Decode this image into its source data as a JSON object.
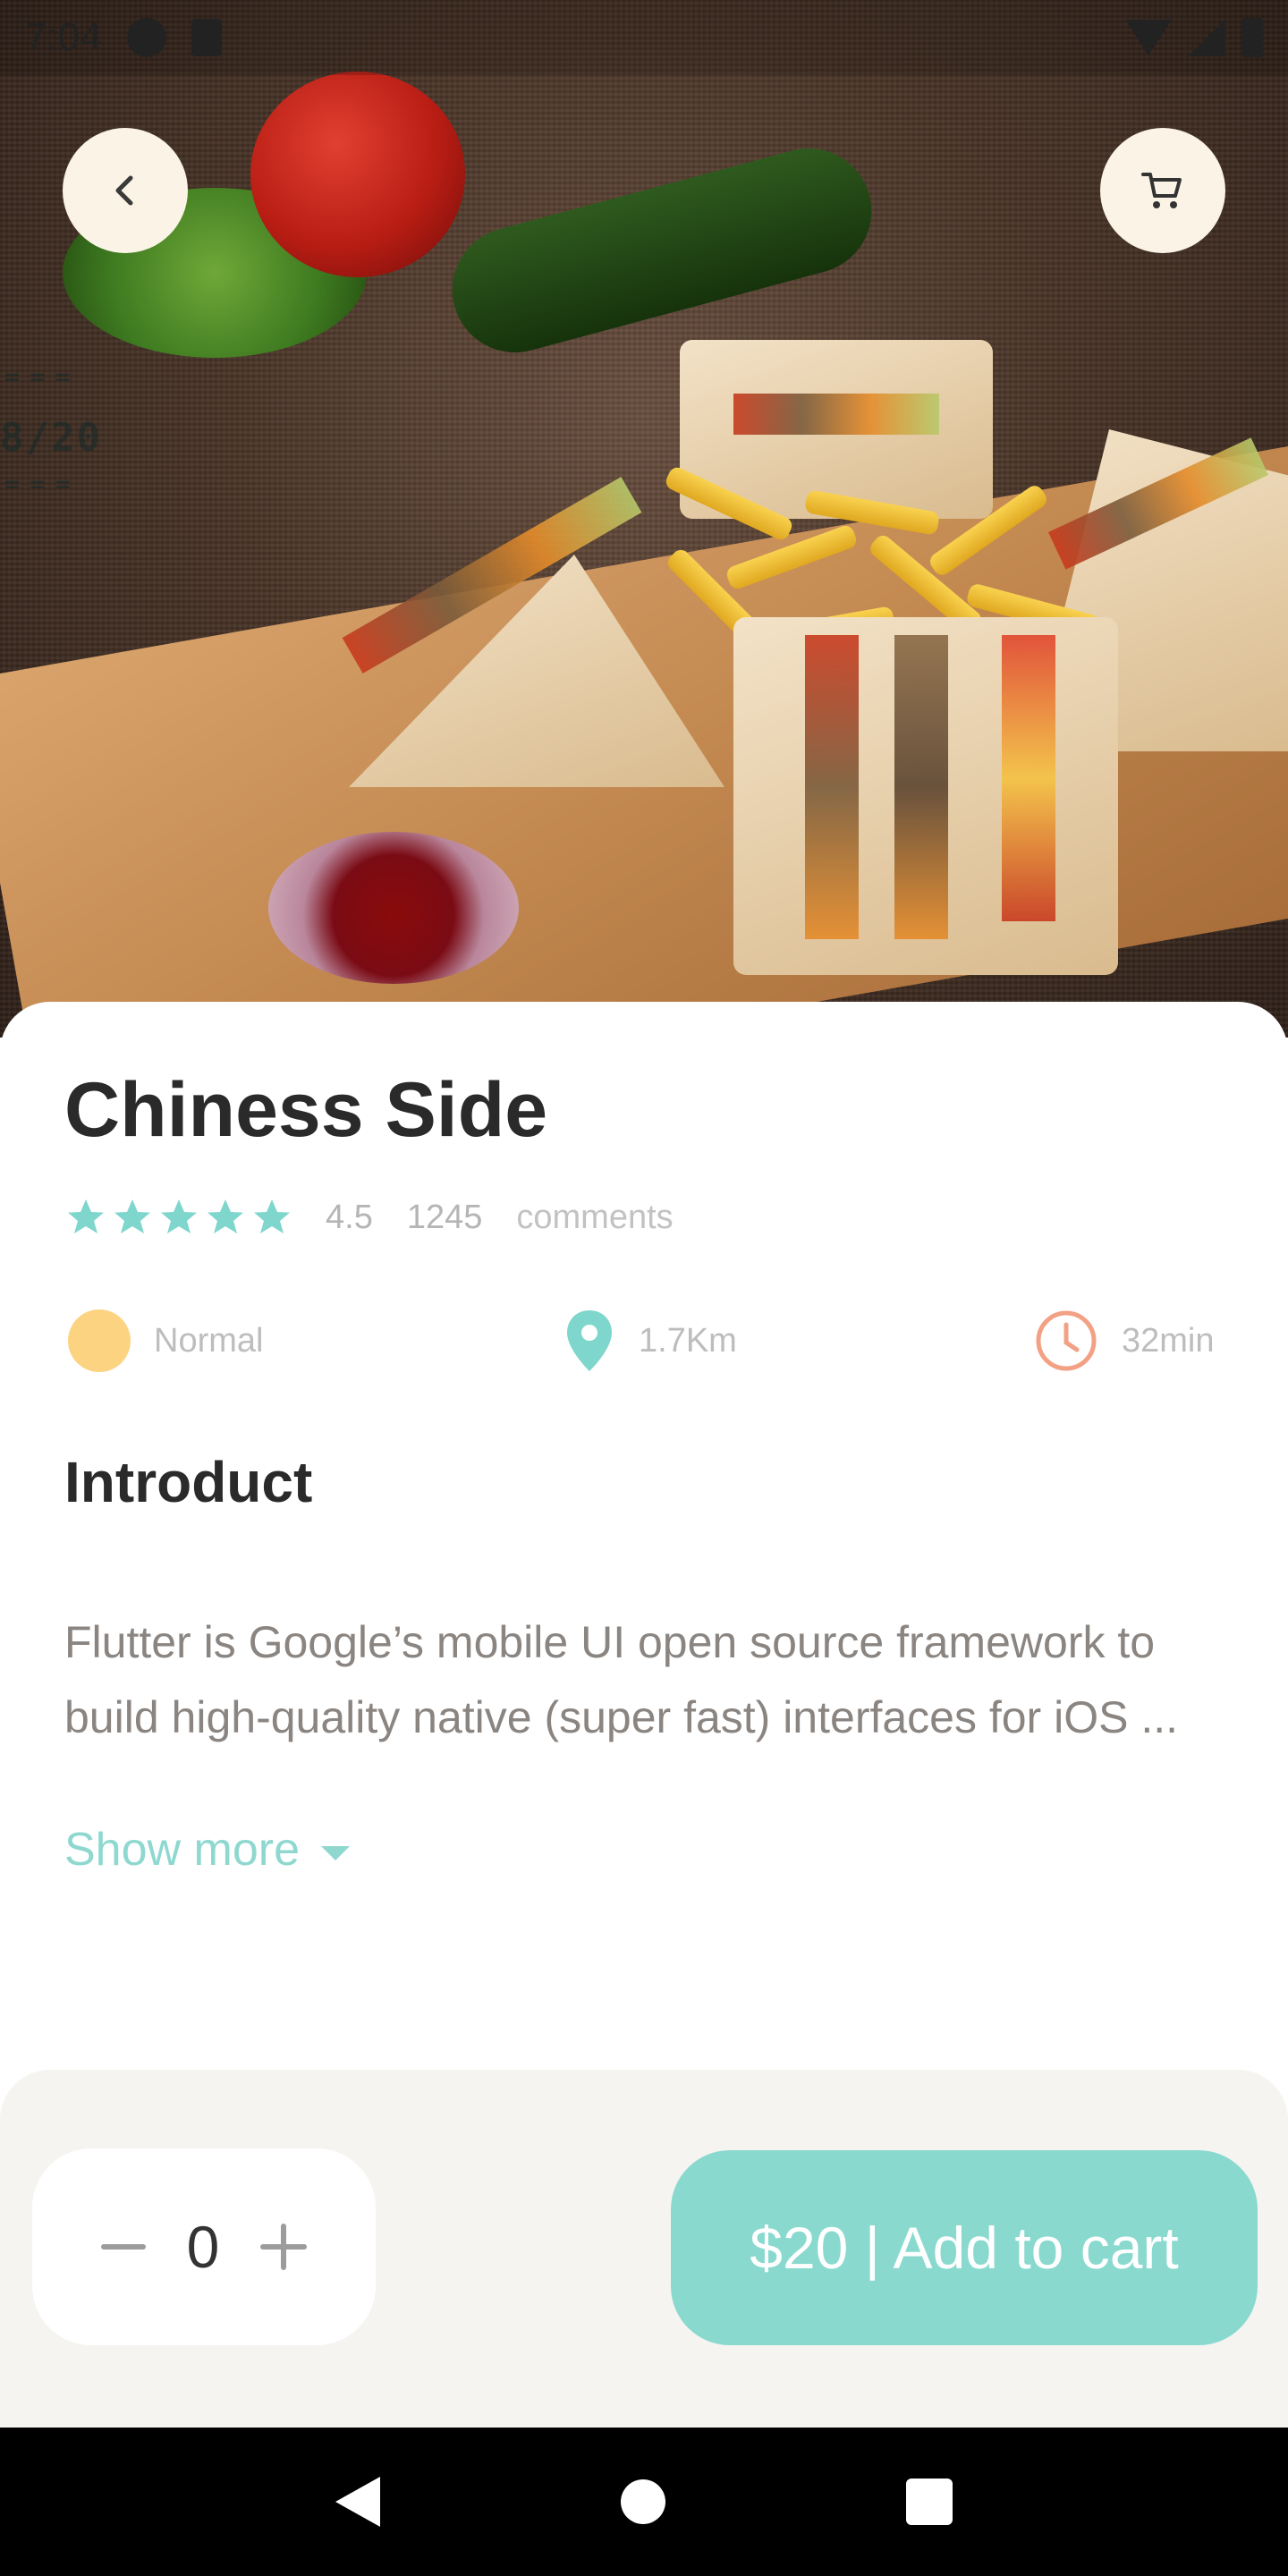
{
  "status_bar": {
    "time": "7:04"
  },
  "header": {
    "back_icon": "chevron-left-icon",
    "cart_icon": "shopping-cart-icon"
  },
  "product": {
    "name": "Chiness Side",
    "rating": "4.5",
    "review_count": "1245",
    "comments_label": "comments",
    "stars": 5,
    "star_color": "#7fd6cc"
  },
  "info": {
    "level": "Normal",
    "distance": "1.7Km",
    "time": "32min",
    "level_color": "#fcd381",
    "distance_color": "#7fd6cc",
    "time_color": "#f3a184"
  },
  "intro": {
    "title": "Introduct",
    "text": "Flutter is Google’s mobile UI open source framework to build high-quality native (super fast) interfaces for iOS ...",
    "show_more": "Show more"
  },
  "cart": {
    "quantity": "0",
    "button_label": "$20 | Add to cart",
    "accent_color": "#89d9cf"
  }
}
